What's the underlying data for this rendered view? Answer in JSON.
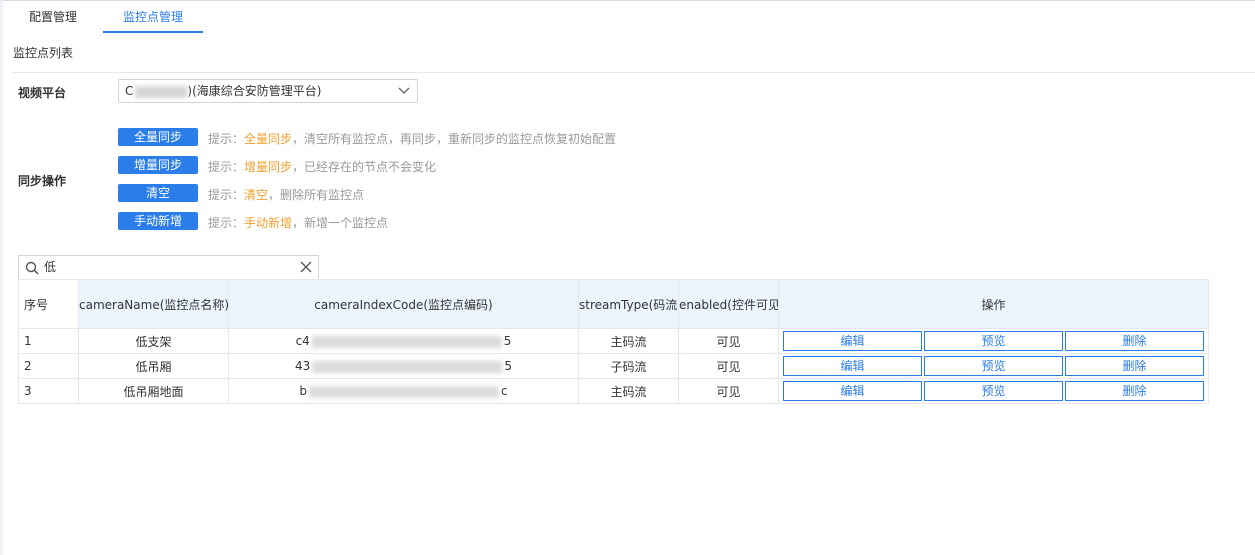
{
  "tabs": [
    {
      "label": "配置管理",
      "active": false
    },
    {
      "label": "监控点管理",
      "active": true
    }
  ],
  "section_title": "监控点列表",
  "platform": {
    "label": "视频平台",
    "selected_prefix": "C",
    "selected_suffix": ")(海康综合安防管理平台)"
  },
  "sync": {
    "label": "同步操作",
    "ops": [
      {
        "button": "全量同步",
        "hint_prefix": "提示：",
        "hint_highlight": "全量同步",
        "hint_rest": "，清空所有监控点，再同步，重新同步的监控点恢复初始配置"
      },
      {
        "button": "增量同步",
        "hint_prefix": "提示：",
        "hint_highlight": "增量同步",
        "hint_rest": "，已经存在的节点不会变化"
      },
      {
        "button": "清空",
        "hint_prefix": "提示：",
        "hint_highlight": "清空",
        "hint_rest": "，删除所有监控点"
      },
      {
        "button": "手动新增",
        "hint_prefix": "提示：",
        "hint_highlight": "手动新增",
        "hint_rest": "，新增一个监控点"
      }
    ]
  },
  "search": {
    "value": "低"
  },
  "table": {
    "headers": [
      "序号",
      "cameraName(监控点名称)",
      "cameraIndexCode(监控点编码)",
      "streamType(码流)",
      "enabled(控件可见)",
      "操作"
    ],
    "rows": [
      {
        "index": "1",
        "name": "低支架",
        "code_start": "c4",
        "code_end": "5",
        "stream": "主码流",
        "enabled": "可见"
      },
      {
        "index": "2",
        "name": "低吊厢",
        "code_start": "43",
        "code_end": "5",
        "stream": "子码流",
        "enabled": "可见"
      },
      {
        "index": "3",
        "name": "低吊厢地面",
        "code_start": "b",
        "code_end": "c",
        "stream": "主码流",
        "enabled": "可见"
      }
    ],
    "actions": {
      "edit": "编辑",
      "preview": "预览",
      "delete": "删除"
    }
  },
  "colors": {
    "accent": "#2b7de9",
    "hint_highlight": "#f0a030",
    "header_highlight": "#ecf5fd"
  }
}
